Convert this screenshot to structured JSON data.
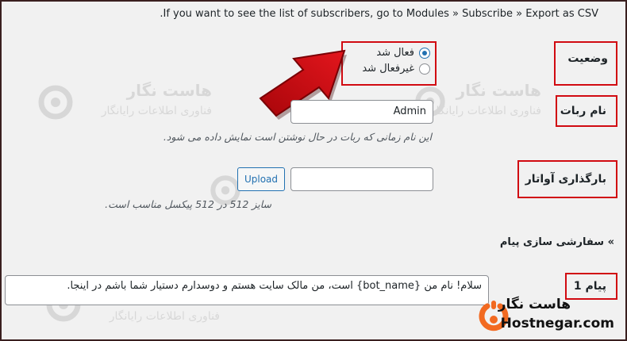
{
  "notice": ".If you want to see the list of subscribers, go to Modules » Subscribe » Export as CSV",
  "status": {
    "label": "وضعیت",
    "options": [
      {
        "label": "فعال شد",
        "checked": true
      },
      {
        "label": "غیرفعال شد",
        "checked": false
      }
    ]
  },
  "bot_name": {
    "label": "نام ربات",
    "value": "Admin",
    "description": "این نام زمانی که ربات در حال نوشتن است نمایش داده می شود."
  },
  "avatar": {
    "label": "بارگذاری آواتار",
    "button": "Upload",
    "description": "سایز 512 در 512 پیکسل مناسب است."
  },
  "customize": {
    "label": "» سفارشی سازی پیام"
  },
  "message1": {
    "label": "پیام 1",
    "value": "سلام! نام من {bot_name} است، من مالک سایت هستم و دوسدارم دستیار شما باشم در اینجا."
  },
  "watermark": {
    "title": "هاست نگار",
    "subtitle": "فناوری اطلاعات رایانگار",
    "partial": "هاست ن"
  },
  "brand": {
    "name_fa": "هاست نگار",
    "name_en": "Hostnegar.com",
    "accent": "#f26a21",
    "highlight": "#d10a11",
    "arrow": "#d10a11"
  }
}
